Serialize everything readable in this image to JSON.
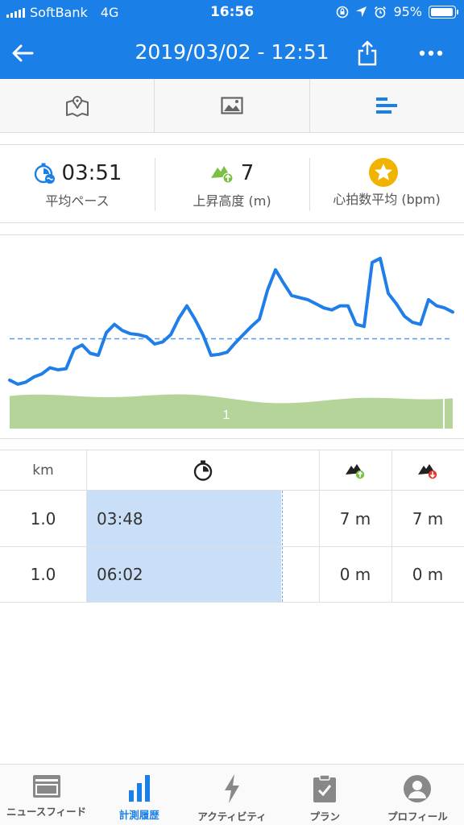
{
  "status_bar": {
    "carrier": "SoftBank",
    "network": "4G",
    "time": "16:56",
    "battery": "95%"
  },
  "header": {
    "title": "2019/03/02 - 12:51",
    "back_icon": "back-arrow-icon",
    "share_icon": "share-icon",
    "more_icon": "more-icon"
  },
  "tabs": [
    {
      "icon": "map-icon"
    },
    {
      "icon": "image-icon"
    },
    {
      "icon": "stats-icon",
      "active": true
    }
  ],
  "stats": [
    {
      "value": "03:51",
      "label": "平均ペース",
      "icon": "pace-icon"
    },
    {
      "value": "7",
      "label": "上昇高度 (m)",
      "icon": "ascent-icon"
    },
    {
      "value": "",
      "label": "心拍数平均 (bpm)",
      "icon": "star-icon"
    }
  ],
  "chart": {
    "lap_label": "1"
  },
  "chart_data": {
    "type": "line",
    "series": [
      {
        "values": [
          0.08,
          0.04,
          0.06,
          0.11,
          0.14,
          0.2,
          0.18,
          0.19,
          0.38,
          0.42,
          0.34,
          0.32,
          0.54,
          0.62,
          0.56,
          0.53,
          0.52,
          0.5,
          0.43,
          0.45,
          0.52,
          0.68,
          0.8,
          0.67,
          0.52,
          0.32,
          0.33,
          0.35,
          0.44,
          0.52,
          0.6,
          0.67,
          0.95,
          1.15,
          1.02,
          0.9,
          0.88,
          0.86,
          0.82,
          0.78,
          0.76,
          0.8,
          0.8,
          0.62,
          0.6,
          1.22,
          1.26,
          0.92,
          0.82,
          0.7,
          0.64,
          0.62,
          0.86,
          0.8,
          0.78,
          0.74
        ]
      }
    ],
    "average_line": 0.48,
    "colors": {
      "line": "#1f7ee8",
      "average": "#5a9be8",
      "elevation": "#b5d49a"
    }
  },
  "laps": {
    "headers": [
      "km",
      "pace-icon",
      "ascent-icon",
      "descent-icon"
    ],
    "rows": [
      {
        "km": "1.0",
        "pace": "03:48",
        "up": "7 m",
        "down": "7 m"
      },
      {
        "km": "1.0",
        "pace": "06:02",
        "up": "0 m",
        "down": "0 m"
      }
    ]
  },
  "bottom_nav": [
    {
      "label": "ニュースフィード",
      "icon": "news-feed-icon"
    },
    {
      "label": "計測履歴",
      "icon": "history-icon",
      "active": true
    },
    {
      "label": "アクティビティ",
      "icon": "activity-icon"
    },
    {
      "label": "プラン",
      "icon": "plan-icon"
    },
    {
      "label": "プロフィール",
      "icon": "profile-icon"
    }
  ],
  "colors": {
    "accent": "#1a7fe6",
    "ascent": "#7cc043",
    "descent": "#e23b2e",
    "star": "#f0b400"
  }
}
